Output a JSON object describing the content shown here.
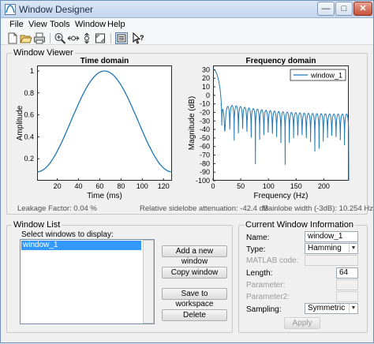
{
  "window": {
    "title": "Window Designer"
  },
  "menu": [
    "File",
    "View",
    "Tools",
    "Window",
    "Help"
  ],
  "toolbar": [
    "new-icon",
    "open-icon",
    "print-icon",
    "zoom-in-icon",
    "zoom-x-icon",
    "zoom-y-icon",
    "full-view-icon",
    "legend-icon",
    "whats-this-icon"
  ],
  "window_viewer": {
    "title": "Window Viewer",
    "time_plot": {
      "title": "Time domain",
      "xlabel": "Time (ms)",
      "ylabel": "Amplitude"
    },
    "freq_plot": {
      "title": "Frequency domain",
      "xlabel": "Frequency (Hz)",
      "ylabel": "Magnitude (dB)",
      "legend": "window_1"
    },
    "leakage": "Leakage Factor: 0.04 %",
    "sidelobe": "Relative sidelobe attenuation: -42.4 dB",
    "mainlobe": "Mainlobe width (-3dB): 10.254 Hz"
  },
  "chart_data": [
    {
      "type": "line",
      "title": "Time domain",
      "xlabel": "Time (ms)",
      "ylabel": "Amplitude",
      "xlim": [
        1,
        128
      ],
      "ylim": [
        0,
        1.05
      ],
      "xticks": [
        20,
        40,
        60,
        80,
        100,
        120
      ],
      "yticks": [
        0.2,
        0.4,
        0.6,
        0.8,
        1
      ],
      "series": [
        {
          "name": "window_1",
          "function": "hamming",
          "length": 64,
          "color": "#1f77b4"
        }
      ]
    },
    {
      "type": "line",
      "title": "Frequency domain",
      "xlabel": "Frequency (Hz)",
      "ylabel": "Magnitude (dB)",
      "xlim": [
        0,
        245
      ],
      "ylim": [
        -100,
        35
      ],
      "xticks": [
        0,
        50,
        100,
        150,
        200
      ],
      "yticks": [
        -100,
        -90,
        -80,
        -70,
        -60,
        -50,
        -40,
        -30,
        -20,
        -10,
        0,
        10,
        20,
        30
      ],
      "legend": "top-right",
      "series": [
        {
          "name": "window_1",
          "function": "hamming_spectrum",
          "peak_db": 31,
          "color": "#1f77b4"
        }
      ]
    }
  ],
  "window_list": {
    "title": "Window List",
    "prompt": "Select windows to display:",
    "items": [
      "window_1"
    ],
    "buttons": {
      "add": "Add a new window",
      "copy": "Copy window",
      "save": "Save to workspace",
      "delete": "Delete"
    }
  },
  "current_info": {
    "title": "Current Window Information",
    "name_label": "Name:",
    "name_value": "window_1",
    "type_label": "Type:",
    "type_value": "Hamming",
    "matlab_label": "MATLAB code:",
    "length_label": "Length:",
    "length_value": "64",
    "parameter_label": "Parameter:",
    "parameter2_label": "Parameter2:",
    "sampling_label": "Sampling:",
    "sampling_value": "Symmetric",
    "apply": "Apply"
  },
  "colors": {
    "line": "#1f77b4",
    "accent": "#3399ff"
  }
}
